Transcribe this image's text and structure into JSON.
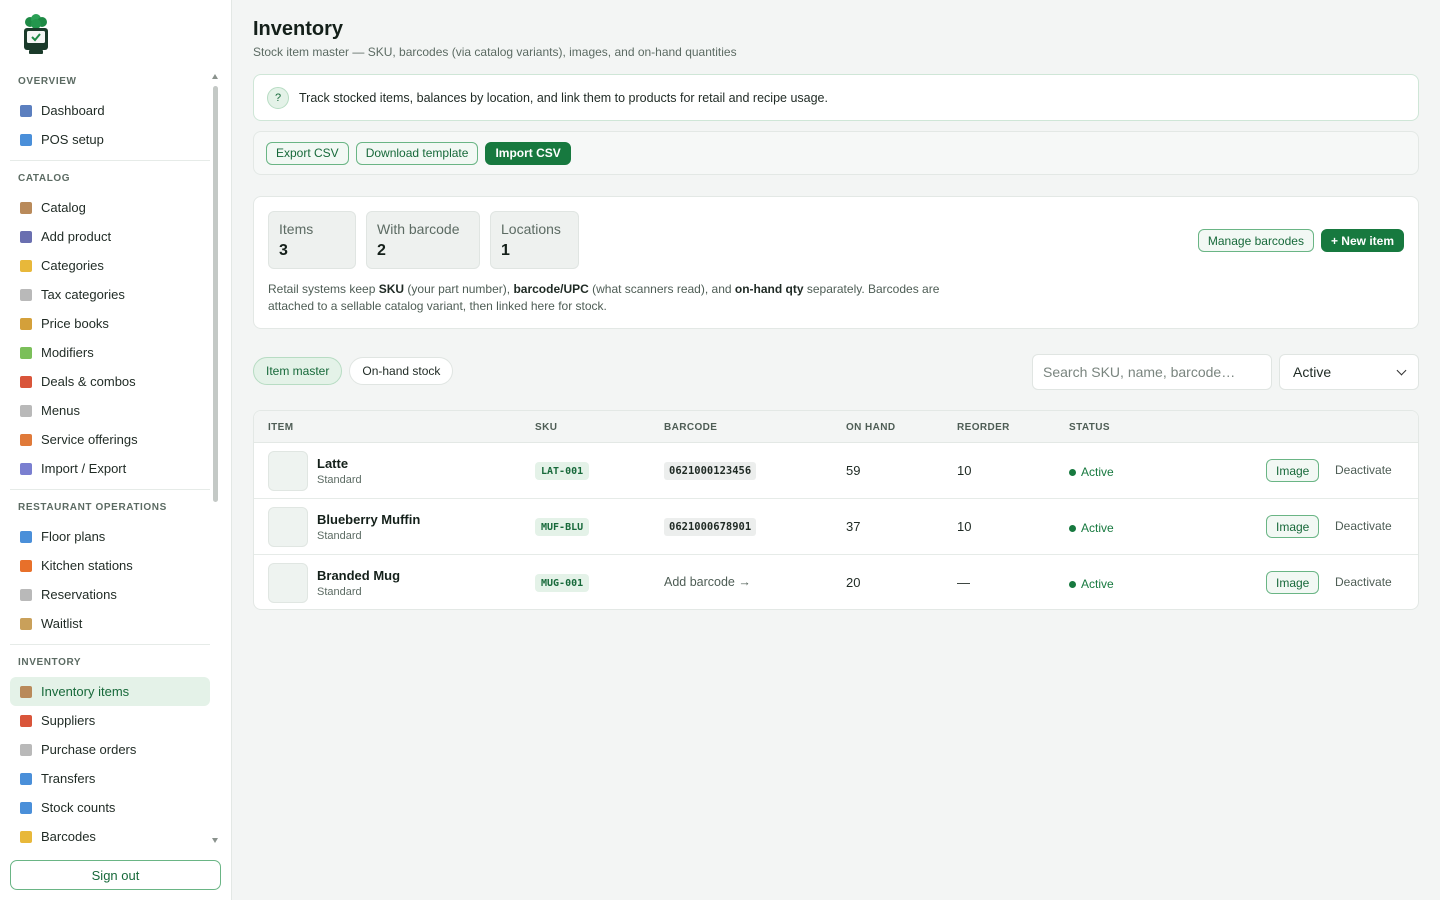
{
  "sidebar": {
    "sections": [
      {
        "title": "OVERVIEW",
        "items": [
          {
            "label": "Dashboard",
            "icon": "bar-chart-icon",
            "color": "#5b7fbf"
          },
          {
            "label": "POS setup",
            "icon": "monitor-icon",
            "color": "#4a8fd9"
          }
        ]
      },
      {
        "title": "CATALOG",
        "items": [
          {
            "label": "Catalog",
            "icon": "box-icon",
            "color": "#b98a5a"
          },
          {
            "label": "Add product",
            "icon": "plus-icon",
            "color": "#6a6fb0"
          },
          {
            "label": "Categories",
            "icon": "folder-icon",
            "color": "#e8b83a"
          },
          {
            "label": "Tax categories",
            "icon": "receipt-icon",
            "color": "#b9b9b9"
          },
          {
            "label": "Price books",
            "icon": "money-bag-icon",
            "color": "#d4a03a"
          },
          {
            "label": "Modifiers",
            "icon": "puzzle-icon",
            "color": "#7bbf5a"
          },
          {
            "label": "Deals & combos",
            "icon": "gift-icon",
            "color": "#d9553a"
          },
          {
            "label": "Menus",
            "icon": "menu-card-icon",
            "color": "#b9b9b9"
          },
          {
            "label": "Service offerings",
            "icon": "person-icon",
            "color": "#e07a3a"
          },
          {
            "label": "Import / Export",
            "icon": "inbox-icon",
            "color": "#7a7fd0"
          }
        ]
      },
      {
        "title": "RESTAURANT OPERATIONS",
        "items": [
          {
            "label": "Floor plans",
            "icon": "map-icon",
            "color": "#4a8fd9"
          },
          {
            "label": "Kitchen stations",
            "icon": "fire-icon",
            "color": "#e8702a"
          },
          {
            "label": "Reservations",
            "icon": "calendar-icon",
            "color": "#b9b9b9"
          },
          {
            "label": "Waitlist",
            "icon": "hourglass-icon",
            "color": "#c9a05a"
          }
        ]
      },
      {
        "title": "INVENTORY",
        "items": [
          {
            "label": "Inventory items",
            "icon": "box-icon",
            "color": "#b98a5a",
            "active": true
          },
          {
            "label": "Suppliers",
            "icon": "truck-icon",
            "color": "#d9553a"
          },
          {
            "label": "Purchase orders",
            "icon": "clipboard-icon",
            "color": "#b9b9b9"
          },
          {
            "label": "Transfers",
            "icon": "transfer-icon",
            "color": "#4a8fd9"
          },
          {
            "label": "Stock counts",
            "icon": "counter-icon",
            "color": "#4a8fd9"
          },
          {
            "label": "Barcodes",
            "icon": "tag-icon",
            "color": "#e8b83a"
          }
        ]
      }
    ],
    "signout_label": "Sign out"
  },
  "header": {
    "title": "Inventory",
    "subtitle": "Stock item master — SKU, barcodes (via catalog variants), images, and on-hand quantities"
  },
  "info": {
    "badge": "?",
    "text": "Track stocked items, balances by location, and link them to products for retail and recipe usage."
  },
  "toolbar": {
    "export_label": "Export CSV",
    "template_label": "Download template",
    "import_label": "Import CSV"
  },
  "summary": {
    "stats": [
      {
        "label": "Items",
        "value": "3"
      },
      {
        "label": "With barcode",
        "value": "2"
      },
      {
        "label": "Locations",
        "value": "1"
      }
    ],
    "note_parts": {
      "p1": "Retail systems keep ",
      "b1": "SKU",
      "p2": " (your part number), ",
      "b2": "barcode/UPC",
      "p3": " (what scanners read), and ",
      "b3": "on-hand qty",
      "p4": " separately. Barcodes are attached to a sellable catalog variant, then linked here for stock."
    },
    "manage_barcodes_label": "Manage barcodes",
    "new_item_label": "+ New item"
  },
  "tabs": [
    {
      "label": "Item master",
      "active": true
    },
    {
      "label": "On-hand stock",
      "active": false
    }
  ],
  "search": {
    "placeholder": "Search SKU, name, barcode…",
    "value": ""
  },
  "status_filter": {
    "selected": "Active"
  },
  "table": {
    "headers": {
      "item": "ITEM",
      "sku": "SKU",
      "barcode": "BARCODE",
      "on_hand": "ON HAND",
      "reorder": "REORDER",
      "status": "STATUS"
    },
    "rows": [
      {
        "name": "Latte",
        "type": "Standard",
        "sku": "LAT-001",
        "barcode": "0621000123456",
        "on_hand": "59",
        "reorder": "10",
        "status": "Active",
        "image_label": "Image",
        "deactivate_label": "Deactivate"
      },
      {
        "name": "Blueberry Muffin",
        "type": "Standard",
        "sku": "MUF-BLU",
        "barcode": "0621000678901",
        "on_hand": "37",
        "reorder": "10",
        "status": "Active",
        "image_label": "Image",
        "deactivate_label": "Deactivate"
      },
      {
        "name": "Branded Mug",
        "type": "Standard",
        "sku": "MUG-001",
        "barcode_action": "Add barcode →",
        "on_hand": "20",
        "reorder": "—",
        "status": "Active",
        "image_label": "Image",
        "deactivate_label": "Deactivate"
      }
    ]
  },
  "colors": {
    "accent": "#17793f",
    "accent_light": "#e4f2e8",
    "border": "#e3e8e5"
  }
}
